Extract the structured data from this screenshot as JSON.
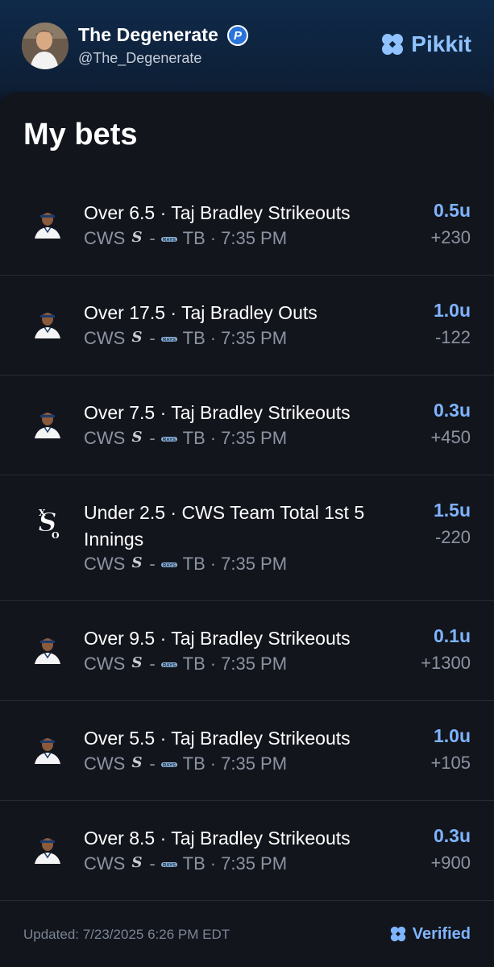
{
  "user": {
    "name": "The Degenerate",
    "badge": "P",
    "handle": "@The_Degenerate"
  },
  "brand": {
    "name": "Pikkit",
    "color": "#8fc2ff"
  },
  "title": "My bets",
  "bets": [
    {
      "title": "Over 6.5 · Taj Bradley Strikeouts",
      "icon": "player-headshot-icon",
      "away": "CWS",
      "home": "TB",
      "time": "7:35 PM",
      "units": "0.5u",
      "odds": "+230"
    },
    {
      "title": "Over 17.5 · Taj Bradley Outs",
      "icon": "player-headshot-icon",
      "away": "CWS",
      "home": "TB",
      "time": "7:35 PM",
      "units": "1.0u",
      "odds": "-122"
    },
    {
      "title": "Over 7.5 · Taj Bradley Strikeouts",
      "icon": "player-headshot-icon",
      "away": "CWS",
      "home": "TB",
      "time": "7:35 PM",
      "units": "0.3u",
      "odds": "+450"
    },
    {
      "title": "Under 2.5 · CWS Team Total 1st 5 Innings",
      "icon": "white-sox-logo-icon",
      "away": "CWS",
      "home": "TB",
      "time": "7:35 PM",
      "units": "1.5u",
      "odds": "-220"
    },
    {
      "title": "Over 9.5 · Taj Bradley Strikeouts",
      "icon": "player-headshot-icon",
      "away": "CWS",
      "home": "TB",
      "time": "7:35 PM",
      "units": "0.1u",
      "odds": "+1300"
    },
    {
      "title": "Over 5.5 · Taj Bradley Strikeouts",
      "icon": "player-headshot-icon",
      "away": "CWS",
      "home": "TB",
      "time": "7:35 PM",
      "units": "1.0u",
      "odds": "+105"
    },
    {
      "title": "Over 8.5 · Taj Bradley Strikeouts",
      "icon": "player-headshot-icon",
      "away": "CWS",
      "home": "TB",
      "time": "7:35 PM",
      "units": "0.3u",
      "odds": "+900"
    }
  ],
  "footer": {
    "updated": "Updated: 7/23/2025 6:26 PM EDT",
    "verified": "Verified"
  },
  "colors": {
    "units": "#7fb4ff",
    "muted": "#8c93a1",
    "card": "#12151c",
    "divider": "#262b36"
  }
}
